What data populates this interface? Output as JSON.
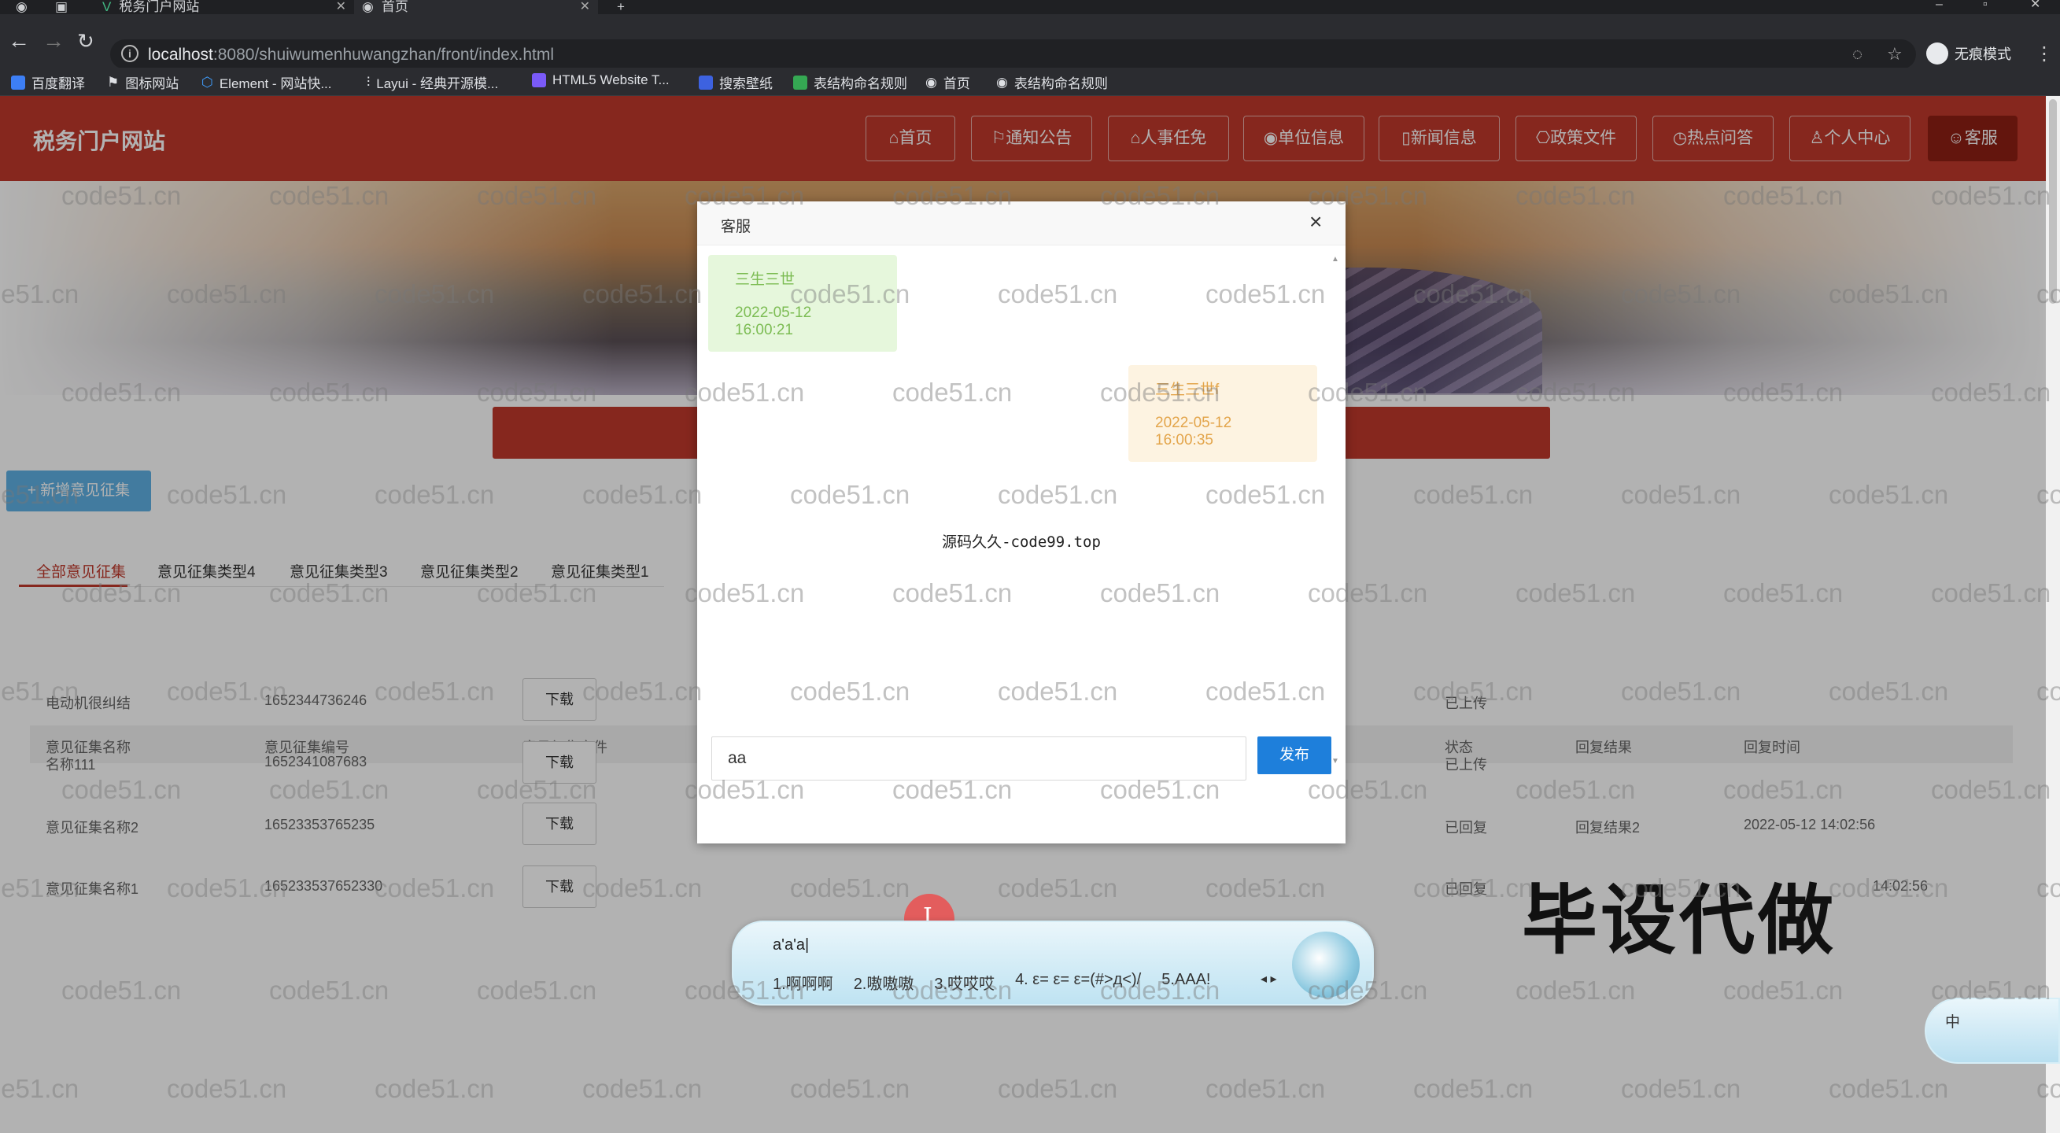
{
  "browser": {
    "tabs": [
      {
        "label": "税务门户网站"
      },
      {
        "label": "首页"
      }
    ],
    "new_tab": "+",
    "url_host": "localhost",
    "url_rest": ":8080/shuiwumenhuwangzhan/front/index.html",
    "incognito_label": "无痕模式",
    "bookmarks": [
      {
        "label": "百度翻译",
        "color": "#3d7ff5"
      },
      {
        "label": "图标网站",
        "color": "#ffffff"
      },
      {
        "label": "Element - 网站快...",
        "color": "#409eff"
      },
      {
        "label": "Layui - 经典开源模...",
        "color": "#cccccc"
      },
      {
        "label": "HTML5 Website T...",
        "color": "#7a5af8"
      },
      {
        "label": "搜索壁纸",
        "color": "#3d62e0"
      },
      {
        "label": "表结构命名规则",
        "color": "#35a853"
      },
      {
        "label": "首页",
        "color": "#dddddd"
      },
      {
        "label": "表结构命名规则",
        "color": "#dddddd"
      }
    ]
  },
  "site": {
    "title": "税务门户网站",
    "nav": [
      {
        "label": "⌂首页"
      },
      {
        "label": "⚐通知公告"
      },
      {
        "label": "⌂人事任免"
      },
      {
        "label": "◉单位信息"
      },
      {
        "label": "▯新闻信息"
      },
      {
        "label": "⎔政策文件"
      },
      {
        "label": "◷热点问答"
      },
      {
        "label": "♙个人中心"
      },
      {
        "label": "☺客服",
        "active": true
      }
    ],
    "add_button": "+ 新增意见征集",
    "categories": [
      "全部意见征集",
      "意见征集类型4",
      "意见征集类型3",
      "意见征集类型2",
      "意见征集类型1"
    ],
    "table": {
      "headers": [
        "意见征集名称",
        "意见征集编号",
        "意见征集文件",
        "状态",
        "回复结果",
        "回复时间"
      ],
      "download_label": "下载",
      "rows": [
        {
          "name": "电动机很纠结",
          "code": "1652344736246",
          "status": "已上传",
          "result": "",
          "time": ""
        },
        {
          "name": "名称111",
          "code": "1652341087683",
          "status": "已上传",
          "result": "",
          "time": ""
        },
        {
          "name": "意见征集名称2",
          "code": "16523353765235",
          "status": "已回复",
          "result": "回复结果2",
          "time": "2022-05-12 14:02:56"
        },
        {
          "name": "意见征集名称1",
          "code": "16523353765233​0",
          "status": "已回复",
          "result": "",
          "time": "14:02:56"
        }
      ]
    }
  },
  "dialog": {
    "title": "客服",
    "close": "×",
    "messages": [
      {
        "side": "left",
        "name": "三生三世",
        "time": "2022-05-12 16:00:21"
      },
      {
        "side": "right",
        "name": "三生三世f",
        "time": "2022-05-12 16:00:35"
      }
    ],
    "center_watermark": "源码久久-code99.top",
    "input_value": "aa",
    "send_label": "发布"
  },
  "ime": {
    "composition": "a'a'a|",
    "candidates": [
      "1.啊啊啊",
      "2.嗷嗷嗷",
      "3.哎哎哎",
      "4. ε= ε= ε=(#>д<)/",
      "5.AAA!"
    ],
    "arrows": "◂ ▸",
    "status_lang": "中"
  },
  "overlay_text": "毕设代做",
  "watermark_text": "code51.cn"
}
